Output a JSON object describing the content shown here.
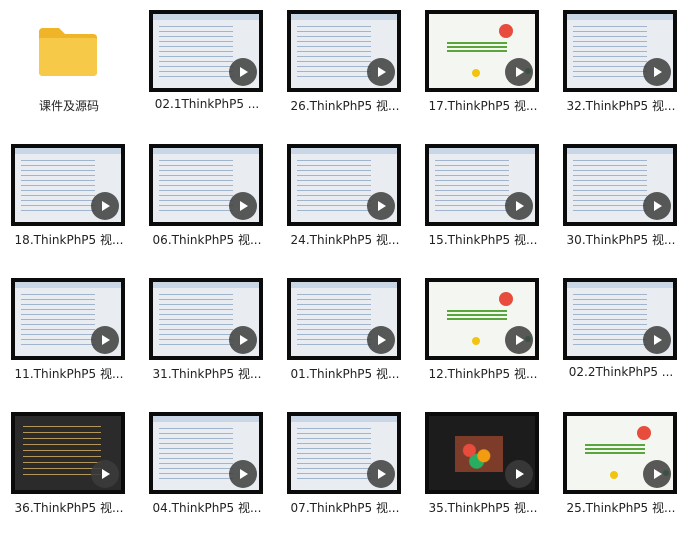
{
  "items": [
    {
      "label": "课件及源码",
      "kind": "folder"
    },
    {
      "label": "02.1ThinkPhP5 ...",
      "kind": "video",
      "thumb": "code"
    },
    {
      "label": "26.ThinkPhP5 视...",
      "kind": "video",
      "thumb": "code"
    },
    {
      "label": "17.ThinkPhP5 视...",
      "kind": "video",
      "thumb": "slide"
    },
    {
      "label": "32.ThinkPhP5 视...",
      "kind": "video",
      "thumb": "code"
    },
    {
      "label": "18.ThinkPhP5 视...",
      "kind": "video",
      "thumb": "code"
    },
    {
      "label": "06.ThinkPhP5 视...",
      "kind": "video",
      "thumb": "code"
    },
    {
      "label": "24.ThinkPhP5 视...",
      "kind": "video",
      "thumb": "code"
    },
    {
      "label": "15.ThinkPhP5 视...",
      "kind": "video",
      "thumb": "code"
    },
    {
      "label": "30.ThinkPhP5 视...",
      "kind": "video",
      "thumb": "code"
    },
    {
      "label": "11.ThinkPhP5 视...",
      "kind": "video",
      "thumb": "code"
    },
    {
      "label": "31.ThinkPhP5 视...",
      "kind": "video",
      "thumb": "code"
    },
    {
      "label": "01.ThinkPhP5 视...",
      "kind": "video",
      "thumb": "code"
    },
    {
      "label": "12.ThinkPhP5 视...",
      "kind": "video",
      "thumb": "slide"
    },
    {
      "label": "02.2ThinkPhP5 ...",
      "kind": "video",
      "thumb": "code"
    },
    {
      "label": "36.ThinkPhP5 视...",
      "kind": "video",
      "thumb": "dark"
    },
    {
      "label": "04.ThinkPhP5 视...",
      "kind": "video",
      "thumb": "code"
    },
    {
      "label": "07.ThinkPhP5 视...",
      "kind": "video",
      "thumb": "code"
    },
    {
      "label": "35.ThinkPhP5 视...",
      "kind": "video",
      "thumb": "photo"
    },
    {
      "label": "25.ThinkPhP5 视...",
      "kind": "video",
      "thumb": "slide"
    }
  ],
  "colors": {
    "folder": "#f7c948",
    "folder_tab": "#f0b429",
    "label": "#222222"
  }
}
